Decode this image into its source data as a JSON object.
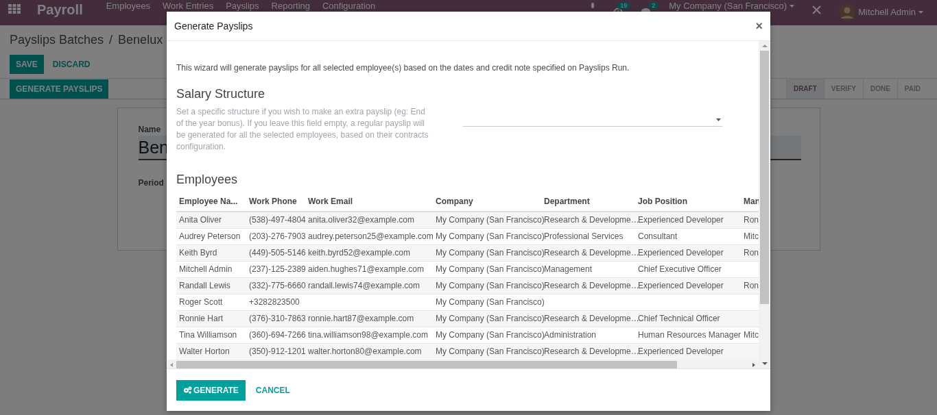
{
  "navbar": {
    "app_title": "Payroll",
    "menu": [
      "Employees",
      "Work Entries",
      "Payslips",
      "Reporting",
      "Configuration"
    ],
    "activity_count": "19",
    "message_count": "2",
    "company": "My Company (San Francisco)",
    "user": "Mitchell Admin"
  },
  "breadcrumb": [
    "Payslips Batches",
    "Benelux"
  ],
  "breadcrumb_separator": "/",
  "actions": [
    {
      "label": "SAVE",
      "kind": "primary"
    },
    {
      "label": "DISCARD",
      "kind": "link"
    }
  ],
  "header_button": "GENERATE PAYSLIPS",
  "stages": [
    {
      "label": "DRAFT",
      "selected": true
    },
    {
      "label": "VERIFY",
      "selected": false
    },
    {
      "label": "DONE",
      "selected": false
    },
    {
      "label": "PAID",
      "selected": false
    }
  ],
  "form": {
    "name_label": "Name",
    "name_value": "Ben",
    "period_label": "Period"
  },
  "dialog": {
    "title": "Generate Payslips",
    "close": "×",
    "intro": "This wizard will generate payslips for all selected employee(s) based on the dates and credit note specified on Payslips Run.",
    "structure_title": "Salary Structure",
    "structure_help": "Set a specific structure if you wish to make an extra payslip (eg: End of the year bonus). If you leave this field empty, a regular payslip will be generated for all the selected employees, based on their contracts configuration.",
    "employees_title": "Employees",
    "columns": [
      "Employee Na...",
      "Work Phone",
      "Work Email",
      "Company",
      "Department",
      "Job Position",
      "Man"
    ],
    "rows": [
      [
        "Anita Oliver",
        "(538)-497-4804",
        "anita.oliver32@example.com",
        "My Company (San Francisco)",
        "Research & Developme…",
        "Experienced Developer",
        "Ron"
      ],
      [
        "Audrey Peterson",
        "(203)-276-7903",
        "audrey.peterson25@example.com",
        "My Company (San Francisco)",
        "Professional Services",
        "Consultant",
        "Mitc"
      ],
      [
        "Keith Byrd",
        "(449)-505-5146",
        "keith.byrd52@example.com",
        "My Company (San Francisco)",
        "Research & Developme…",
        "Experienced Developer",
        "Ron"
      ],
      [
        "Mitchell Admin",
        "(237)-125-2389",
        "aiden.hughes71@example.com",
        "My Company (San Francisco)",
        "Management",
        "Chief Executive Officer",
        ""
      ],
      [
        "Randall Lewis",
        "(332)-775-6660",
        "randall.lewis74@example.com",
        "My Company (San Francisco)",
        "Research & Developme…",
        "Experienced Developer",
        "Ron"
      ],
      [
        "Roger Scott",
        "+3282823500",
        "",
        "My Company (San Francisco)",
        "",
        "",
        ""
      ],
      [
        "Ronnie Hart",
        "(376)-310-7863",
        "ronnie.hart87@example.com",
        "My Company (San Francisco)",
        "Research & Developme…",
        "Chief Technical Officer",
        ""
      ],
      [
        "Tina Williamson",
        "(360)-694-7266",
        "tina.williamson98@example.com",
        "My Company (San Francisco)",
        "Administration",
        "Human Resources Manager",
        "Mitc"
      ],
      [
        "Walter Horton",
        "(350)-912-1201",
        "walter.horton80@example.com",
        "My Company (San Francisco)",
        "Research & Developme…",
        "Experienced Developer",
        ""
      ]
    ],
    "buttons": [
      {
        "label": "GENERATE",
        "kind": "primary"
      },
      {
        "label": "CANCEL",
        "kind": "link"
      }
    ]
  }
}
